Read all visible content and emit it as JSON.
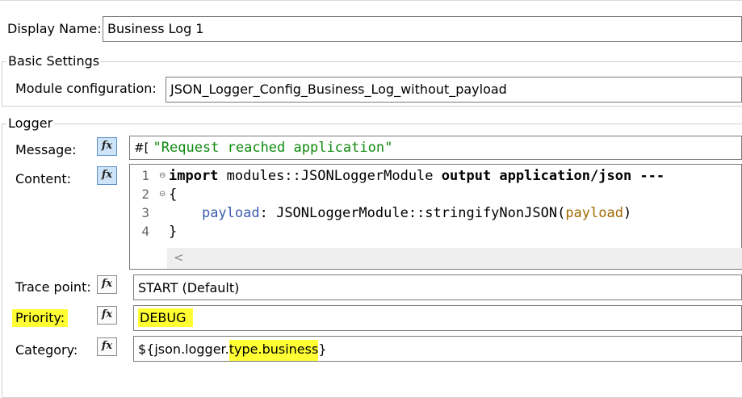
{
  "display": {
    "label": "Display Name:",
    "value": "Business Log 1"
  },
  "basic": {
    "title": "Basic Settings",
    "module_label": "Module configuration:",
    "module_value": "JSON_Logger_Config_Business_Log_without_payload"
  },
  "logger": {
    "title": "Logger",
    "fx_glyph": "fx",
    "message": {
      "label": "Message:",
      "prefix": "#[",
      "value": "\"Request reached application\""
    },
    "content": {
      "label": "Content:",
      "line_numbers": [
        "1",
        "2",
        "3",
        "4"
      ],
      "line1": {
        "kw1": "import",
        "mid": " modules::JSONLoggerModule ",
        "kw2": "output",
        "rest": " application/json ---"
      },
      "line2": "{",
      "line3": {
        "indent": "    ",
        "key": "payload",
        "mid": ": JSONLoggerModule::stringifyNonJSON(",
        "var": "payload",
        "end": ")"
      },
      "line4": "}",
      "scroll_left": "<"
    },
    "trace": {
      "label": "Trace point:",
      "value": "START (Default)"
    },
    "priority": {
      "label": "Priority:",
      "value": "DEBUG"
    },
    "category": {
      "label": "Category:",
      "value_prefix": "${json.logger.",
      "value_highlight": "type.business",
      "value_suffix": "}"
    }
  },
  "colors": {
    "highlight": "#ffff33",
    "fx_active": "#cde3f7",
    "keyword_blue": "#3b5cad",
    "variable_orange": "#a06a00",
    "string_green": "#108a10"
  }
}
